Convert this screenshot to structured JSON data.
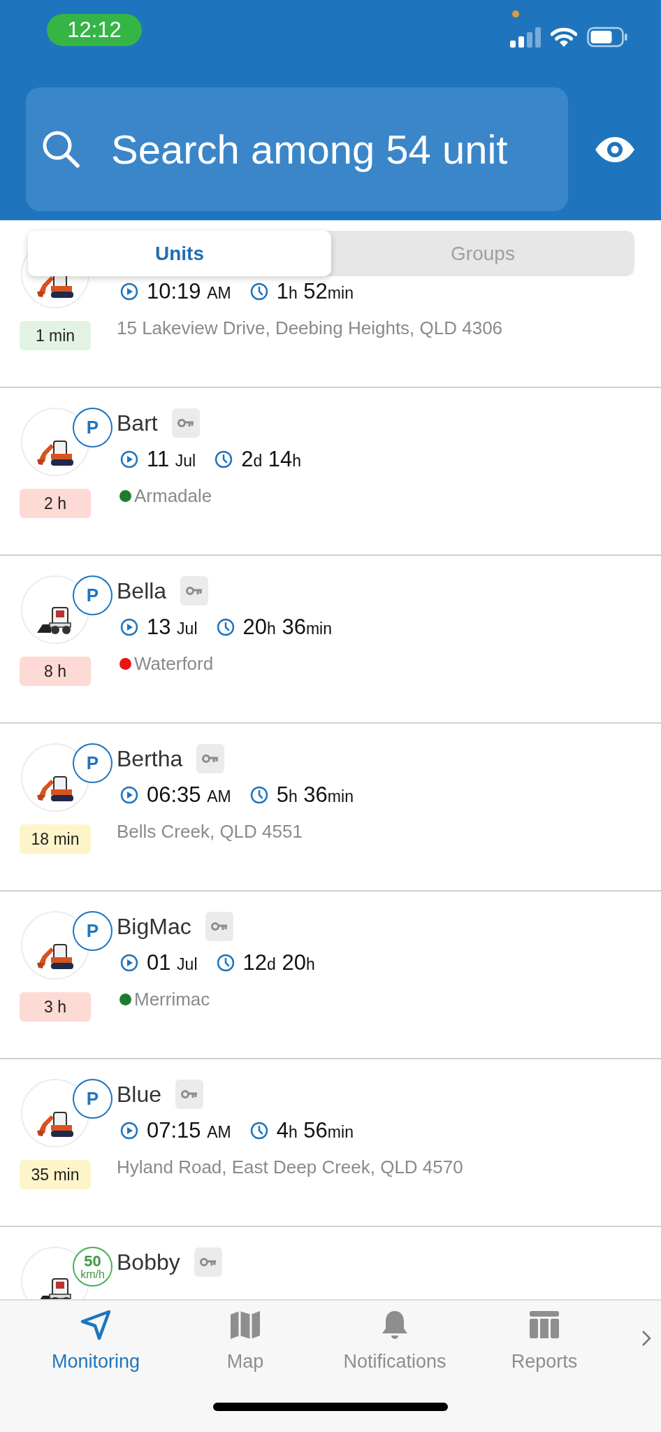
{
  "status_bar": {
    "time": "12:12"
  },
  "search": {
    "placeholder": "Search among 54 unit"
  },
  "tabs": [
    {
      "label": "Units",
      "selected": true
    },
    {
      "label": "Groups",
      "selected": false
    }
  ],
  "units": [
    {
      "kind": "excavator",
      "start": {
        "value": "10:19",
        "unit": "AM"
      },
      "duration": [
        {
          "value": "1",
          "unit": "h"
        },
        {
          "value": "52",
          "unit": "min"
        }
      ],
      "location": {
        "kind": "address",
        "text": "15 Lakeview Drive, Deebing Heights, QLD 4306"
      },
      "age": {
        "text": "1 min",
        "color": "#e2f3e4"
      }
    },
    {
      "kind": "excavator",
      "badge": {
        "kind": "parking",
        "text": "P"
      },
      "name": "Bart",
      "start": {
        "value": "11",
        "unit": "Jul"
      },
      "duration": [
        {
          "value": "2",
          "unit": "d"
        },
        {
          "value": "14",
          "unit": "h"
        }
      ],
      "location": {
        "kind": "geofence",
        "text": "Armadale",
        "color": "#1e7b32"
      },
      "age": {
        "text": "2 h",
        "color": "#fddad4"
      }
    },
    {
      "kind": "loader",
      "badge": {
        "kind": "parking",
        "text": "P"
      },
      "name": "Bella",
      "start": {
        "value": "13",
        "unit": "Jul"
      },
      "duration": [
        {
          "value": "20",
          "unit": "h"
        },
        {
          "value": "36",
          "unit": "min"
        }
      ],
      "location": {
        "kind": "geofence",
        "text": "Waterford",
        "color": "#ee1111"
      },
      "age": {
        "text": "8 h",
        "color": "#fddad4"
      }
    },
    {
      "kind": "excavator",
      "badge": {
        "kind": "parking",
        "text": "P"
      },
      "name": "Bertha",
      "start": {
        "value": "06:35",
        "unit": "AM"
      },
      "duration": [
        {
          "value": "5",
          "unit": "h"
        },
        {
          "value": "36",
          "unit": "min"
        }
      ],
      "location": {
        "kind": "address",
        "text": "Bells Creek, QLD 4551"
      },
      "age": {
        "text": "18 min",
        "color": "#fdf5c9"
      }
    },
    {
      "kind": "excavator",
      "badge": {
        "kind": "parking",
        "text": "P"
      },
      "name": "BigMac",
      "start": {
        "value": "01",
        "unit": "Jul"
      },
      "duration": [
        {
          "value": "12",
          "unit": "d"
        },
        {
          "value": "20",
          "unit": "h"
        }
      ],
      "location": {
        "kind": "geofence",
        "text": "Merrimac",
        "color": "#1e7b32"
      },
      "age": {
        "text": "3 h",
        "color": "#fddad4"
      }
    },
    {
      "kind": "excavator",
      "badge": {
        "kind": "parking",
        "text": "P"
      },
      "name": "Blue",
      "start": {
        "value": "07:15",
        "unit": "AM"
      },
      "duration": [
        {
          "value": "4",
          "unit": "h"
        },
        {
          "value": "56",
          "unit": "min"
        }
      ],
      "location": {
        "kind": "address",
        "text": "Hyland Road, East Deep Creek, QLD 4570"
      },
      "age": {
        "text": "35 min",
        "color": "#fdf5c9"
      }
    },
    {
      "kind": "loader",
      "badge": {
        "kind": "speed",
        "value": "50",
        "unit": "km/h"
      },
      "name": "Bobby"
    }
  ],
  "nav": [
    {
      "label": "Monitoring",
      "selected": true
    },
    {
      "label": "Map",
      "selected": false
    },
    {
      "label": "Notifications",
      "selected": false
    },
    {
      "label": "Reports",
      "selected": false
    }
  ]
}
